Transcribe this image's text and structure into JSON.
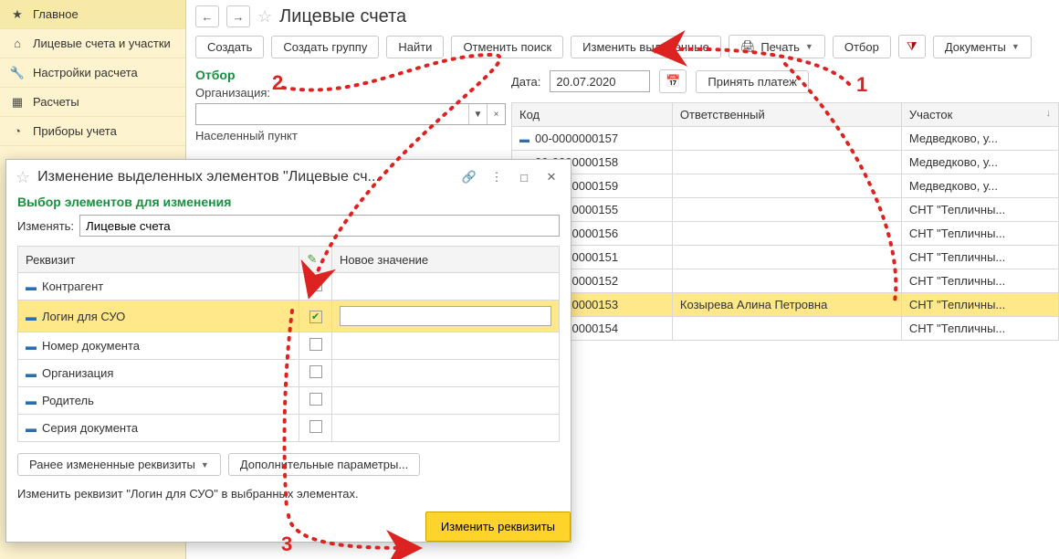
{
  "sidebar": {
    "items": [
      {
        "label": "Главное"
      },
      {
        "label": "Лицевые счета и участки"
      },
      {
        "label": "Настройки расчета"
      },
      {
        "label": "Расчеты"
      },
      {
        "label": "Приборы учета"
      }
    ]
  },
  "page": {
    "title": "Лицевые счета"
  },
  "toolbar": {
    "create": "Создать",
    "create_group": "Создать группу",
    "find": "Найти",
    "cancel_find": "Отменить поиск",
    "change_selected": "Изменить выделенные",
    "print": "Печать",
    "filter": "Отбор",
    "documents": "Документы"
  },
  "filter": {
    "title": "Отбор",
    "org_label": "Организация:",
    "settlement_label": "Населенный пункт"
  },
  "date": {
    "label": "Дата:",
    "value": "20.07.2020"
  },
  "accept_payment": "Принять платеж",
  "grid": {
    "cols": {
      "code": "Код",
      "responsible": "Ответственный",
      "area": "Участок"
    },
    "rows": [
      {
        "code": "00-0000000157",
        "resp": "",
        "area": "Медведково, у..."
      },
      {
        "code": "00-0000000158",
        "resp": "",
        "area": "Медведково, у..."
      },
      {
        "code": "00-0000000159",
        "resp": "",
        "area": "Медведково, у..."
      },
      {
        "code": "00-0000000155",
        "resp": "",
        "area": "СНТ \"Тепличны..."
      },
      {
        "code": "00-0000000156",
        "resp": "",
        "area": "СНТ \"Тепличны..."
      },
      {
        "code": "00-0000000151",
        "resp": "",
        "area": "СНТ \"Тепличны..."
      },
      {
        "code": "00-0000000152",
        "resp": "",
        "area": "СНТ \"Тепличны..."
      },
      {
        "code": "00-0000000153",
        "resp": "Козырева Алина Петровна",
        "area": "СНТ \"Тепличны...",
        "selected": true
      },
      {
        "code": "00-0000000154",
        "resp": "",
        "area": "СНТ \"Тепличны..."
      }
    ]
  },
  "dialog": {
    "title": "Изменение выделенных элементов \"Лицевые сч...",
    "subtitle": "Выбор элементов для изменения",
    "change_label": "Изменять:",
    "change_value": "Лицевые счета",
    "th_req": "Реквизит",
    "th_val": "Новое значение",
    "attrs": [
      {
        "name": "Контрагент",
        "checked": false
      },
      {
        "name": "Логин для СУО",
        "checked": true,
        "selected": true
      },
      {
        "name": "Номер документа",
        "checked": false
      },
      {
        "name": "Организация",
        "checked": false
      },
      {
        "name": "Родитель",
        "checked": false
      },
      {
        "name": "Серия документа",
        "checked": false
      }
    ],
    "prev_changed": "Ранее измененные реквизиты",
    "extra_params": "Дополнительные параметры...",
    "status": "Изменить реквизит \"Логин для СУО\" в выбранных элементах.",
    "apply": "Изменить реквизиты"
  },
  "anno": {
    "one": "1",
    "two": "2",
    "three": "3"
  }
}
